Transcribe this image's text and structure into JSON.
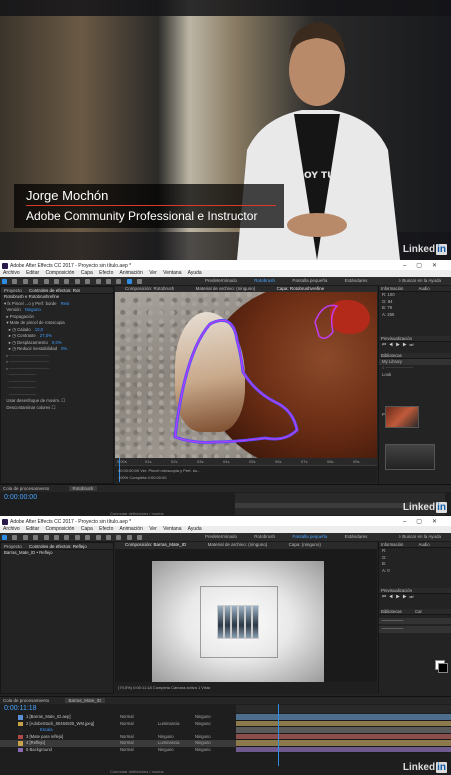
{
  "frame1": {
    "name": "Jorge Mochón",
    "role": "Adobe Community Professional e Instructor",
    "shirt_text": "OY TU ADRE",
    "watermark": "Linked",
    "watermark_in": "in"
  },
  "app": {
    "title": "Adobe After Effects CC 2017 - Proyecto sin título.aep *",
    "menu": [
      "Archivo",
      "Editar",
      "Composición",
      "Capa",
      "Efecto",
      "Animación",
      "Ver",
      "Ventana",
      "Ayuda"
    ],
    "workspaces": [
      "Predeterminado",
      "Rotobrush",
      "Pantalla pequeña",
      "Estándares"
    ],
    "search_help": "Buscar en la Ayuda"
  },
  "frame2": {
    "left_panel_tab": "Proyecto",
    "effects_tab": "Controles de efectos: Rot",
    "layer_title": "Rotobrush e Rotobrushrefine",
    "effect_rows": [
      {
        "label": "Pincel ...o y Perf. borde",
        "value": "Rest"
      },
      {
        "label": "Versión",
        "value": "Ninguno"
      },
      {
        "label": "Propagación",
        "value": ""
      },
      {
        "label": "Mate de pincel de rotoscopia",
        "value": ""
      },
      {
        "label": "Calado",
        "value": "10,0"
      },
      {
        "label": "Contraste",
        "value": "27,0%"
      },
      {
        "label": "Desplazamiento",
        "value": "0,0%"
      },
      {
        "label": "Reducir inestabilidad",
        "value": "0%"
      },
      {
        "label": "Usar desenfoque de movim.",
        "value": ""
      },
      {
        "label": "Descontaminar colores",
        "value": ""
      }
    ],
    "viewer_tabs": [
      "Composición: Rotobrush",
      "Material de archivo: (ninguno)",
      "Capa: Rotobrushvrefine"
    ],
    "ruler": [
      "0:00s",
      "01s",
      "02s",
      "03s",
      "04s",
      "05s",
      "06s",
      "07s",
      "08s",
      "09s"
    ],
    "viewer_ctrl": "00:00:00:00   Ver:  Pincel rotoscopia y Perf. bo...",
    "viewer_ctrl2": "100%   Completa   0:00:00:00",
    "timeline_tabs": [
      "Cola de procesamiento",
      "Rotobrush"
    ],
    "timecode": "0:00:00:00",
    "timeline_foot": "Conmutar definidores / modos",
    "right_panels": [
      "Información",
      "Audio",
      "Previsualización",
      "Bibliotecas",
      "My Library",
      "Look",
      "Plantillas"
    ],
    "info_values": [
      "R: 100",
      "G: 84",
      "B: 79",
      "A: 255"
    ],
    "watermark": "Linked",
    "watermark_in": "in"
  },
  "frame3": {
    "left_panel_tab": "Proyecto",
    "effects_tab": "Controles de efectos: Reflejo",
    "project_item": "Barras_Mate_ID • Reflejo",
    "viewer_tabs": [
      "Composición: Barras_Mate_ID",
      "Material de archivo: (ninguno)",
      "Capa: (ninguno)"
    ],
    "viewer_ctrl": "(79,5%)   0:00:11:18   Completa   Cámara activa   1 Vista",
    "timeline_tabs": [
      "Cola de procesamiento",
      "Barras_Mate_ID"
    ],
    "timecode": "0:00:11:18",
    "layers": [
      {
        "num": "1",
        "name": "[Barras_Mate_ID.aep]",
        "mode": "Normal",
        "matte": "",
        "parent": "Ninguno",
        "color": "#5b8fd6"
      },
      {
        "num": "2",
        "name": "[AdobeStock_60484925_WM.jpeg]",
        "mode": "Normal",
        "matte": "Luminancia",
        "parent": "Ninguno",
        "color": "#c8a24a"
      },
      {
        "num": "",
        "name": "Escala",
        "mode": "",
        "matte": "",
        "parent": "",
        "color": "#232323"
      },
      {
        "num": "3",
        "name": "[Mate para reflejo]",
        "mode": "Normal",
        "matte": "Ninguno",
        "parent": "Ninguno",
        "color": "#b04a4a"
      },
      {
        "num": "4",
        "name": "[Reflejo]",
        "mode": "Normal",
        "matte": "Luminancia",
        "parent": "Ninguno",
        "color": "#c8a24a"
      },
      {
        "num": "5",
        "name": "Background",
        "mode": "Normal",
        "matte": "Ninguno",
        "parent": "Ninguno",
        "color": "#8a6ab0"
      }
    ],
    "track_colors": [
      "#4d6e8c",
      "#8c7a4d",
      "#5a5a5a",
      "#8c4d4d",
      "#8c7a4d",
      "#6e5a8c"
    ],
    "right_panels": [
      "Información",
      "Audio",
      "Previsualización",
      "Bibliotecas",
      "Car"
    ],
    "info_values": [
      "R:",
      "G:",
      "B:",
      "A: 0"
    ],
    "timeline_foot": "Conmutar definidores / modos",
    "watermark": "Linked",
    "watermark_in": "in"
  }
}
